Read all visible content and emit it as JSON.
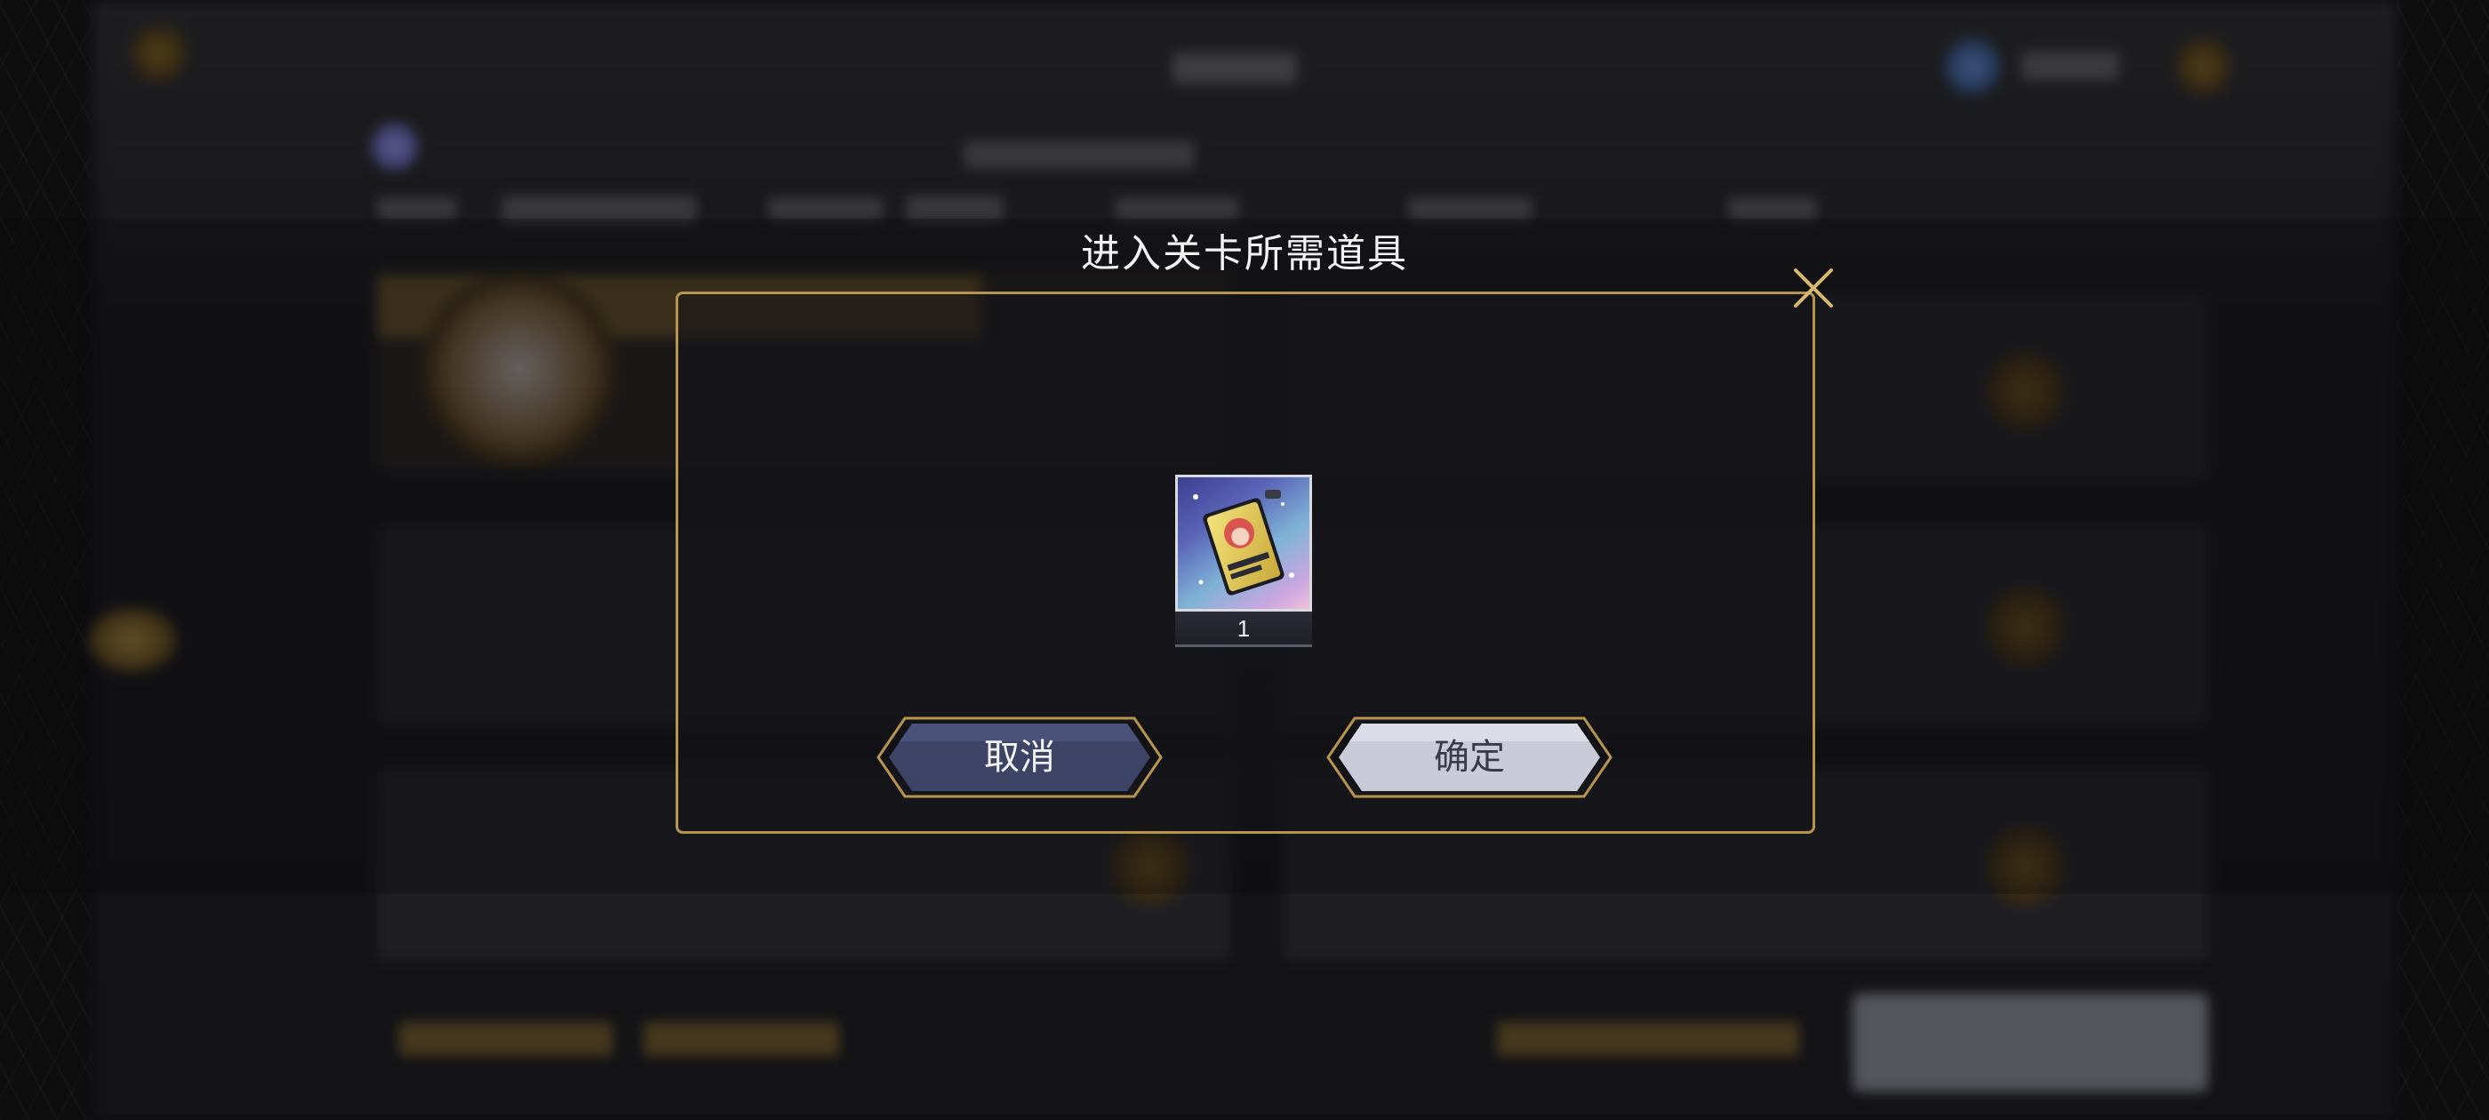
{
  "dialog": {
    "title": "进入关卡所需道具",
    "close_icon": "close-icon",
    "item": {
      "icon": "ticket-card-item-icon",
      "count": "1"
    },
    "cancel_label": "取消",
    "confirm_label": "确定"
  },
  "colors": {
    "frame_gold": "#b8954f",
    "cancel_button": "#3d4466",
    "confirm_button": "#c9ccd8",
    "title_text": "#f2f2f2"
  }
}
